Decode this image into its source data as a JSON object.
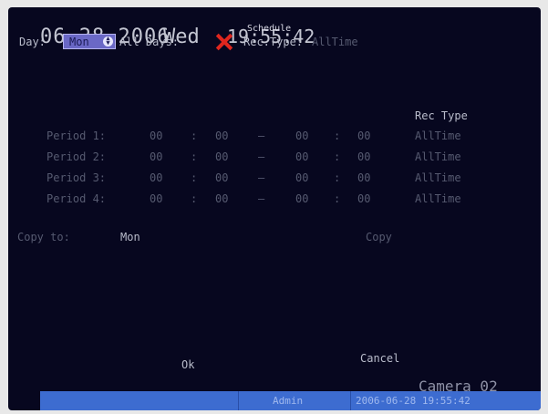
{
  "header": {
    "date": "06-28-2006",
    "day_of_week": "Wed",
    "time": "19:55:42",
    "title_overlay": "Schedule"
  },
  "controls": {
    "day_label": "Day:",
    "day_value": "Mon",
    "all_days_label": "All Days:",
    "all_days_checked": false,
    "rec_type_label": "Rec.Type:",
    "rec_type_value": "AllTime"
  },
  "table": {
    "rec_type_header": "Rec Type",
    "periods": [
      {
        "label": "Period 1:",
        "start_h": "00",
        "start_m": "00",
        "dash": "—",
        "end_h": "00",
        "end_m": "00",
        "type": "AllTime"
      },
      {
        "label": "Period 2:",
        "start_h": "00",
        "start_m": "00",
        "dash": "—",
        "end_h": "00",
        "end_m": "00",
        "type": "AllTime"
      },
      {
        "label": "Period 3:",
        "start_h": "00",
        "start_m": "00",
        "dash": "—",
        "end_h": "00",
        "end_m": "00",
        "type": "AllTime"
      },
      {
        "label": "Period 4:",
        "start_h": "00",
        "start_m": "00",
        "dash": "—",
        "end_h": "00",
        "end_m": "00",
        "type": "AllTime"
      }
    ],
    "sep": ":"
  },
  "copy": {
    "copy_to_label": "Copy to:",
    "copy_to_value": "Mon",
    "copy_button": "Copy"
  },
  "footer": {
    "ok_button": "Ok",
    "cancel_button": "Cancel",
    "camera_label": "Camera 02",
    "status_user": "Admin",
    "status_datetime": "2006-06-28 19:55:42"
  },
  "colors": {
    "screen_bg": "#07071f",
    "status_bar": "#3d6cd0",
    "select_bg": "#6a68c6",
    "cross": "#e0261e"
  }
}
